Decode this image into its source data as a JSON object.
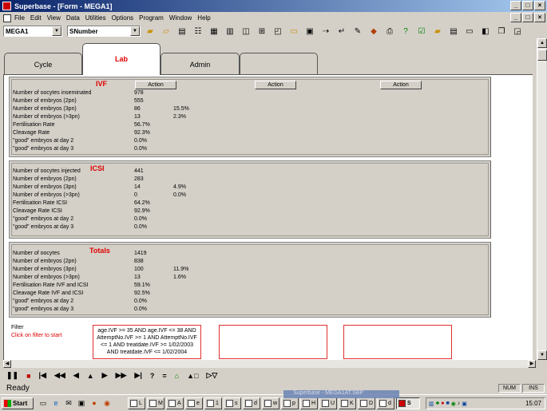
{
  "window": {
    "title": "Superbase - [Form - MEGA1]",
    "controls": [
      "_",
      "□",
      "×"
    ]
  },
  "menu": [
    "File",
    "Edit",
    "View",
    "Data",
    "Utilities",
    "Options",
    "Program",
    "Window",
    "Help"
  ],
  "toolbar": {
    "form_select": "MEGA1",
    "field_select": "SNumber"
  },
  "tabs": [
    "Cycle",
    "Lab",
    "Admin",
    ""
  ],
  "action_label": "Action",
  "ivf": {
    "title": "IVF",
    "rows": [
      {
        "label": "Number of oocytes inseminated",
        "value": "978",
        "pct": ""
      },
      {
        "label": "Number of embryos (2pn)",
        "value": "555",
        "pct": ""
      },
      {
        "label": "Number of embryos (3pn)",
        "value": "86",
        "pct": "15.5%"
      },
      {
        "label": "Number of embryos (>3pn)",
        "value": "13",
        "pct": "2.3%"
      },
      {
        "label": "Fertilisation Rate",
        "value": "56.7%",
        "pct": ""
      },
      {
        "label": "Cleavage Rate",
        "value": "92.3%",
        "pct": ""
      },
      {
        "label": "\"good\" embryos at day 2",
        "value": "0.0%",
        "pct": ""
      },
      {
        "label": "\"good\" embryos at day 3",
        "value": "0.0%",
        "pct": ""
      }
    ]
  },
  "icsi": {
    "title": "ICSI",
    "rows": [
      {
        "label": "Number of oocytes injected",
        "value": "441",
        "pct": ""
      },
      {
        "label": "Number of embryos (2pn)",
        "value": "283",
        "pct": ""
      },
      {
        "label": "Number of embryos (3pn)",
        "value": "14",
        "pct": "4.9%"
      },
      {
        "label": "Number of embryos (>3pn)",
        "value": "0",
        "pct": "0.0%"
      },
      {
        "label": "Fertilisation Rate ICSI",
        "value": "64.2%",
        "pct": ""
      },
      {
        "label": "Cleavage Rate ICSI",
        "value": "92.9%",
        "pct": ""
      },
      {
        "label": "\"good\" embryos at day 2",
        "value": "0.0%",
        "pct": ""
      },
      {
        "label": "\"good\" embryos at day 3",
        "value": "0.0%",
        "pct": ""
      }
    ]
  },
  "totals": {
    "title": "Totals",
    "rows": [
      {
        "label": "Number of oocytes",
        "value": "1419",
        "pct": ""
      },
      {
        "label": "Number of embryos (2pn)",
        "value": "838",
        "pct": ""
      },
      {
        "label": "Number of embryos (3pn)",
        "value": "100",
        "pct": "11.9%"
      },
      {
        "label": "Number of embryos (>3pn)",
        "value": "13",
        "pct": "1.6%"
      },
      {
        "label": "Fertilisation Rate IVF and ICSI",
        "value": "59.1%",
        "pct": ""
      },
      {
        "label": "Cleavage Rate IVF and ICSI",
        "value": "92.5%",
        "pct": ""
      },
      {
        "label": "\"good\" embryos at day 2",
        "value": "0.0%",
        "pct": ""
      },
      {
        "label": "\"good\" embryos at day 3",
        "value": "0.0%",
        "pct": ""
      }
    ]
  },
  "filter": {
    "label": "Filter",
    "hint": "Click on filter to start",
    "expression": "age.IVF >= 35 AND age.IVF <= 38 AND AttemptNo.IVF >= 1 AND AttemptNo.IVF <= 1 AND treatdate.IVF >= 1/02/2003 AND treatdate.IVF <= 1/02/2004"
  },
  "navbar": [
    "❚❚",
    "■",
    "|◀",
    "◀◀",
    "◀",
    "▲",
    "▶",
    "▶▶",
    "▶|",
    "?",
    "=",
    "⌂",
    "▲□",
    "▷▽"
  ],
  "status": {
    "text": "Ready",
    "num": "NUM",
    "ins": "INS"
  },
  "taskbar": {
    "start": "Start",
    "ghost_title": "Superbase - MEGA1AT.SBP",
    "items": [
      "L",
      "M",
      "A",
      "e",
      "1",
      "s",
      "d",
      "w",
      "p",
      "H",
      "U",
      "K",
      "D",
      "d",
      "S"
    ],
    "clock": "15:07"
  },
  "colors": {
    "title_start": "#0a246a",
    "title_end": "#a6caf0",
    "section_title": "#e00000",
    "filter_border": "#e03030"
  }
}
